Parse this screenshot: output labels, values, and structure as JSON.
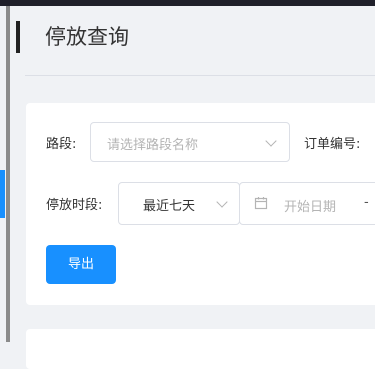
{
  "page": {
    "title": "停放查询"
  },
  "filters": {
    "road": {
      "label": "路段:",
      "placeholder": "请选择路段名称"
    },
    "order_no": {
      "label": "订单编号:"
    },
    "period": {
      "label": "停放时段:",
      "quick_range": "最近七天",
      "start_placeholder": "开始日期",
      "separator": "-"
    }
  },
  "actions": {
    "export_label": "导出"
  },
  "colors": {
    "primary": "#1890ff",
    "topbar": "#20202a"
  }
}
